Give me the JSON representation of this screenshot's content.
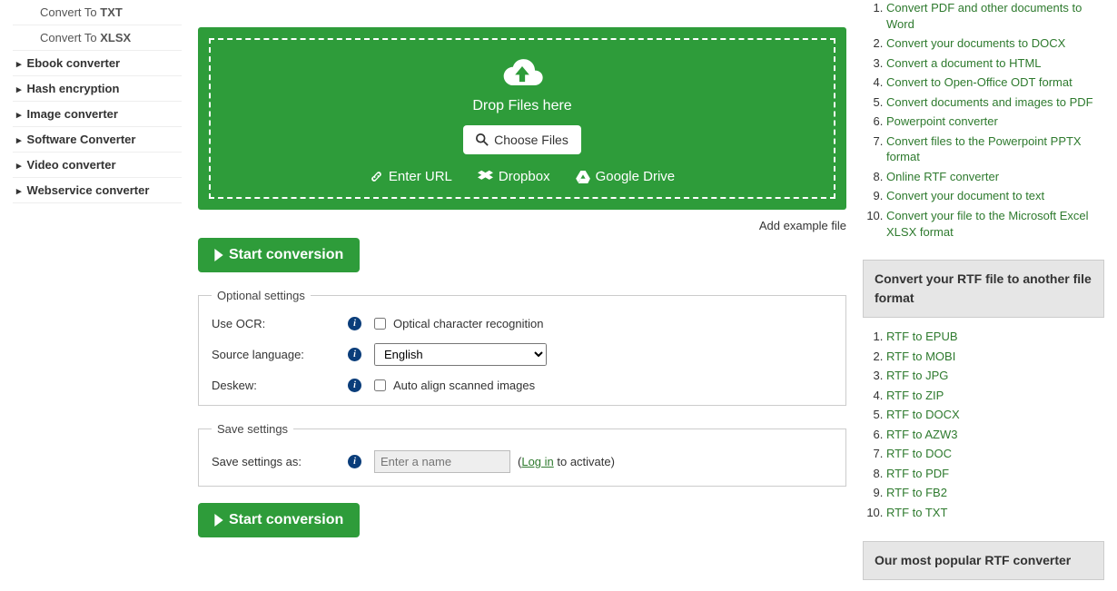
{
  "sidebar": {
    "sub1": {
      "prefix": "Convert To ",
      "fmt": "TXT"
    },
    "sub2": {
      "prefix": "Convert To ",
      "fmt": "XLSX"
    },
    "cats": [
      "Ebook converter",
      "Hash encryption",
      "Image converter",
      "Software Converter",
      "Video converter",
      "Webservice converter"
    ]
  },
  "drop": {
    "text": "Drop Files here",
    "choose": "Choose Files",
    "url": "Enter URL",
    "dropbox": "Dropbox",
    "gdrive": "Google Drive"
  },
  "example_link": "Add example file",
  "start_label": "Start conversion",
  "optional": {
    "legend": "Optional settings",
    "ocr_label": "Use OCR:",
    "ocr_text": "Optical character recognition",
    "lang_label": "Source language:",
    "lang_value": "English",
    "deskew_label": "Deskew:",
    "deskew_text": "Auto align scanned images"
  },
  "save": {
    "legend": "Save settings",
    "label": "Save settings as:",
    "placeholder": "Enter a name",
    "login": "Log in",
    "suffix_open": " (",
    "suffix_close": " to activate)"
  },
  "right1": [
    "Convert PDF and other documents to Word",
    "Convert your documents to DOCX",
    "Convert a document to HTML",
    "Convert to Open-Office ODT format",
    "Convert documents and images to PDF",
    "Powerpoint converter",
    "Convert files to the Powerpoint PPTX format",
    "Online RTF converter",
    "Convert your document to text",
    "Convert your file to the Microsoft Excel XLSX format"
  ],
  "right2_head": "Convert your RTF file to another file format",
  "right2": [
    "RTF to EPUB",
    "RTF to MOBI",
    "RTF to JPG",
    "RTF to ZIP",
    "RTF to DOCX",
    "RTF to AZW3",
    "RTF to DOC",
    "RTF to PDF",
    "RTF to FB2",
    "RTF to TXT"
  ],
  "right3_head": "Our most popular RTF converter"
}
